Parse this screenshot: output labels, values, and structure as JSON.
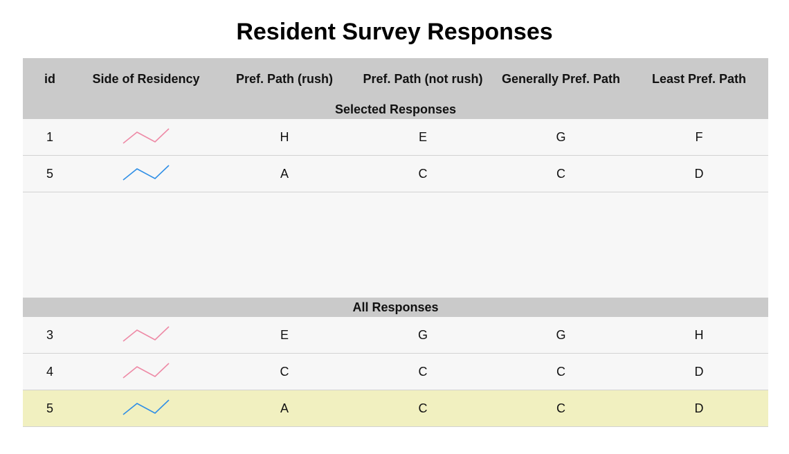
{
  "title": "Resident Survey Responses",
  "columns": [
    "id",
    "Side of Residency",
    "Pref. Path (rush)",
    "Pref. Path (not rush)",
    "Generally Pref. Path",
    "Least Pref. Path"
  ],
  "colors": {
    "pink_side": "#ee8aa6",
    "blue_side": "#2f8fe6",
    "highlight_row": "#f1f0c0",
    "header_bg": "#cacaca"
  },
  "selected": {
    "label": "Selected Responses",
    "rows": [
      {
        "id": "1",
        "side_icon": "pink-sparkline-icon",
        "rush": "H",
        "not_rush": "E",
        "general": "G",
        "least": "F"
      },
      {
        "id": "5",
        "side_icon": "blue-sparkline-icon",
        "rush": "A",
        "not_rush": "C",
        "general": "C",
        "least": "D"
      }
    ]
  },
  "all": {
    "label": "All Responses",
    "rows": [
      {
        "id": "3",
        "side_icon": "pink-sparkline-icon",
        "rush": "E",
        "not_rush": "G",
        "general": "G",
        "least": "H"
      },
      {
        "id": "4",
        "side_icon": "pink-sparkline-icon",
        "rush": "C",
        "not_rush": "C",
        "general": "C",
        "least": "D"
      },
      {
        "id": "5",
        "side_icon": "blue-sparkline-icon",
        "rush": "A",
        "not_rush": "C",
        "general": "C",
        "least": "D"
      }
    ]
  }
}
